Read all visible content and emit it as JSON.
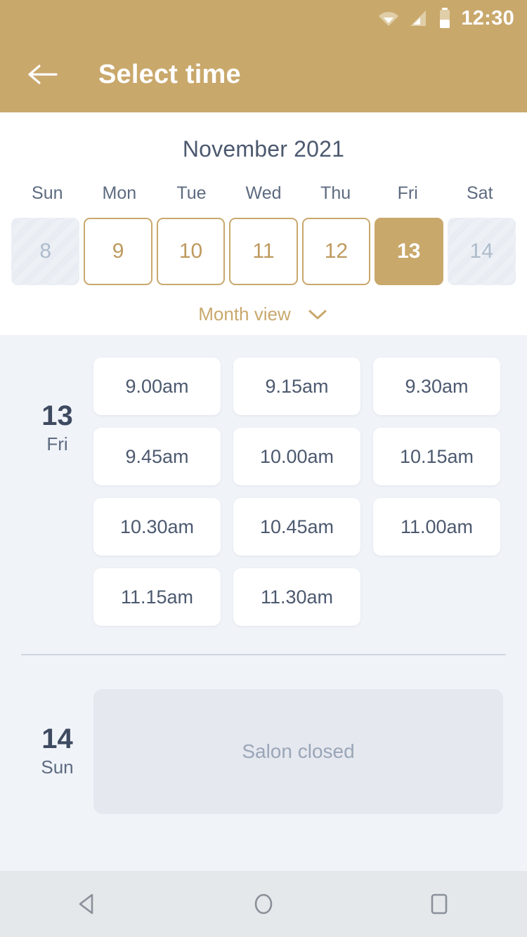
{
  "status_bar": {
    "time": "12:30",
    "icons": [
      "wifi-icon",
      "signal-icon",
      "battery-icon"
    ]
  },
  "app_bar": {
    "back_icon": "back-arrow-icon",
    "title": "Select time"
  },
  "calendar": {
    "month_title": "November 2021",
    "weekdays": [
      "Sun",
      "Mon",
      "Tue",
      "Wed",
      "Thu",
      "Fri",
      "Sat"
    ],
    "days": [
      {
        "number": "8",
        "state": "disabled"
      },
      {
        "number": "9",
        "state": "available"
      },
      {
        "number": "10",
        "state": "available"
      },
      {
        "number": "11",
        "state": "available"
      },
      {
        "number": "12",
        "state": "available"
      },
      {
        "number": "13",
        "state": "selected"
      },
      {
        "number": "14",
        "state": "disabled"
      }
    ],
    "month_view_label": "Month view",
    "month_view_icon": "chevron-down-icon"
  },
  "schedule": [
    {
      "day_number": "13",
      "day_of_week": "Fri",
      "slots": [
        "9.00am",
        "9.15am",
        "9.30am",
        "9.45am",
        "10.00am",
        "10.15am",
        "10.30am",
        "10.45am",
        "11.00am",
        "11.15am",
        "11.30am"
      ],
      "closed_message": null
    },
    {
      "day_number": "14",
      "day_of_week": "Sun",
      "slots": [],
      "closed_message": "Salon closed"
    }
  ],
  "nav_bar": {
    "back": "nav-back-icon",
    "home": "nav-home-icon",
    "recents": "nav-recents-icon"
  },
  "colors": {
    "brand_gold": "#C9A86C",
    "gold_text": "#BE9A5E",
    "surface": "#F0F3F8",
    "card": "#FFFFFF",
    "text_dark": "#3E4A60",
    "text_muted": "#5D6B80",
    "closed_card": "#E5E8EE"
  }
}
